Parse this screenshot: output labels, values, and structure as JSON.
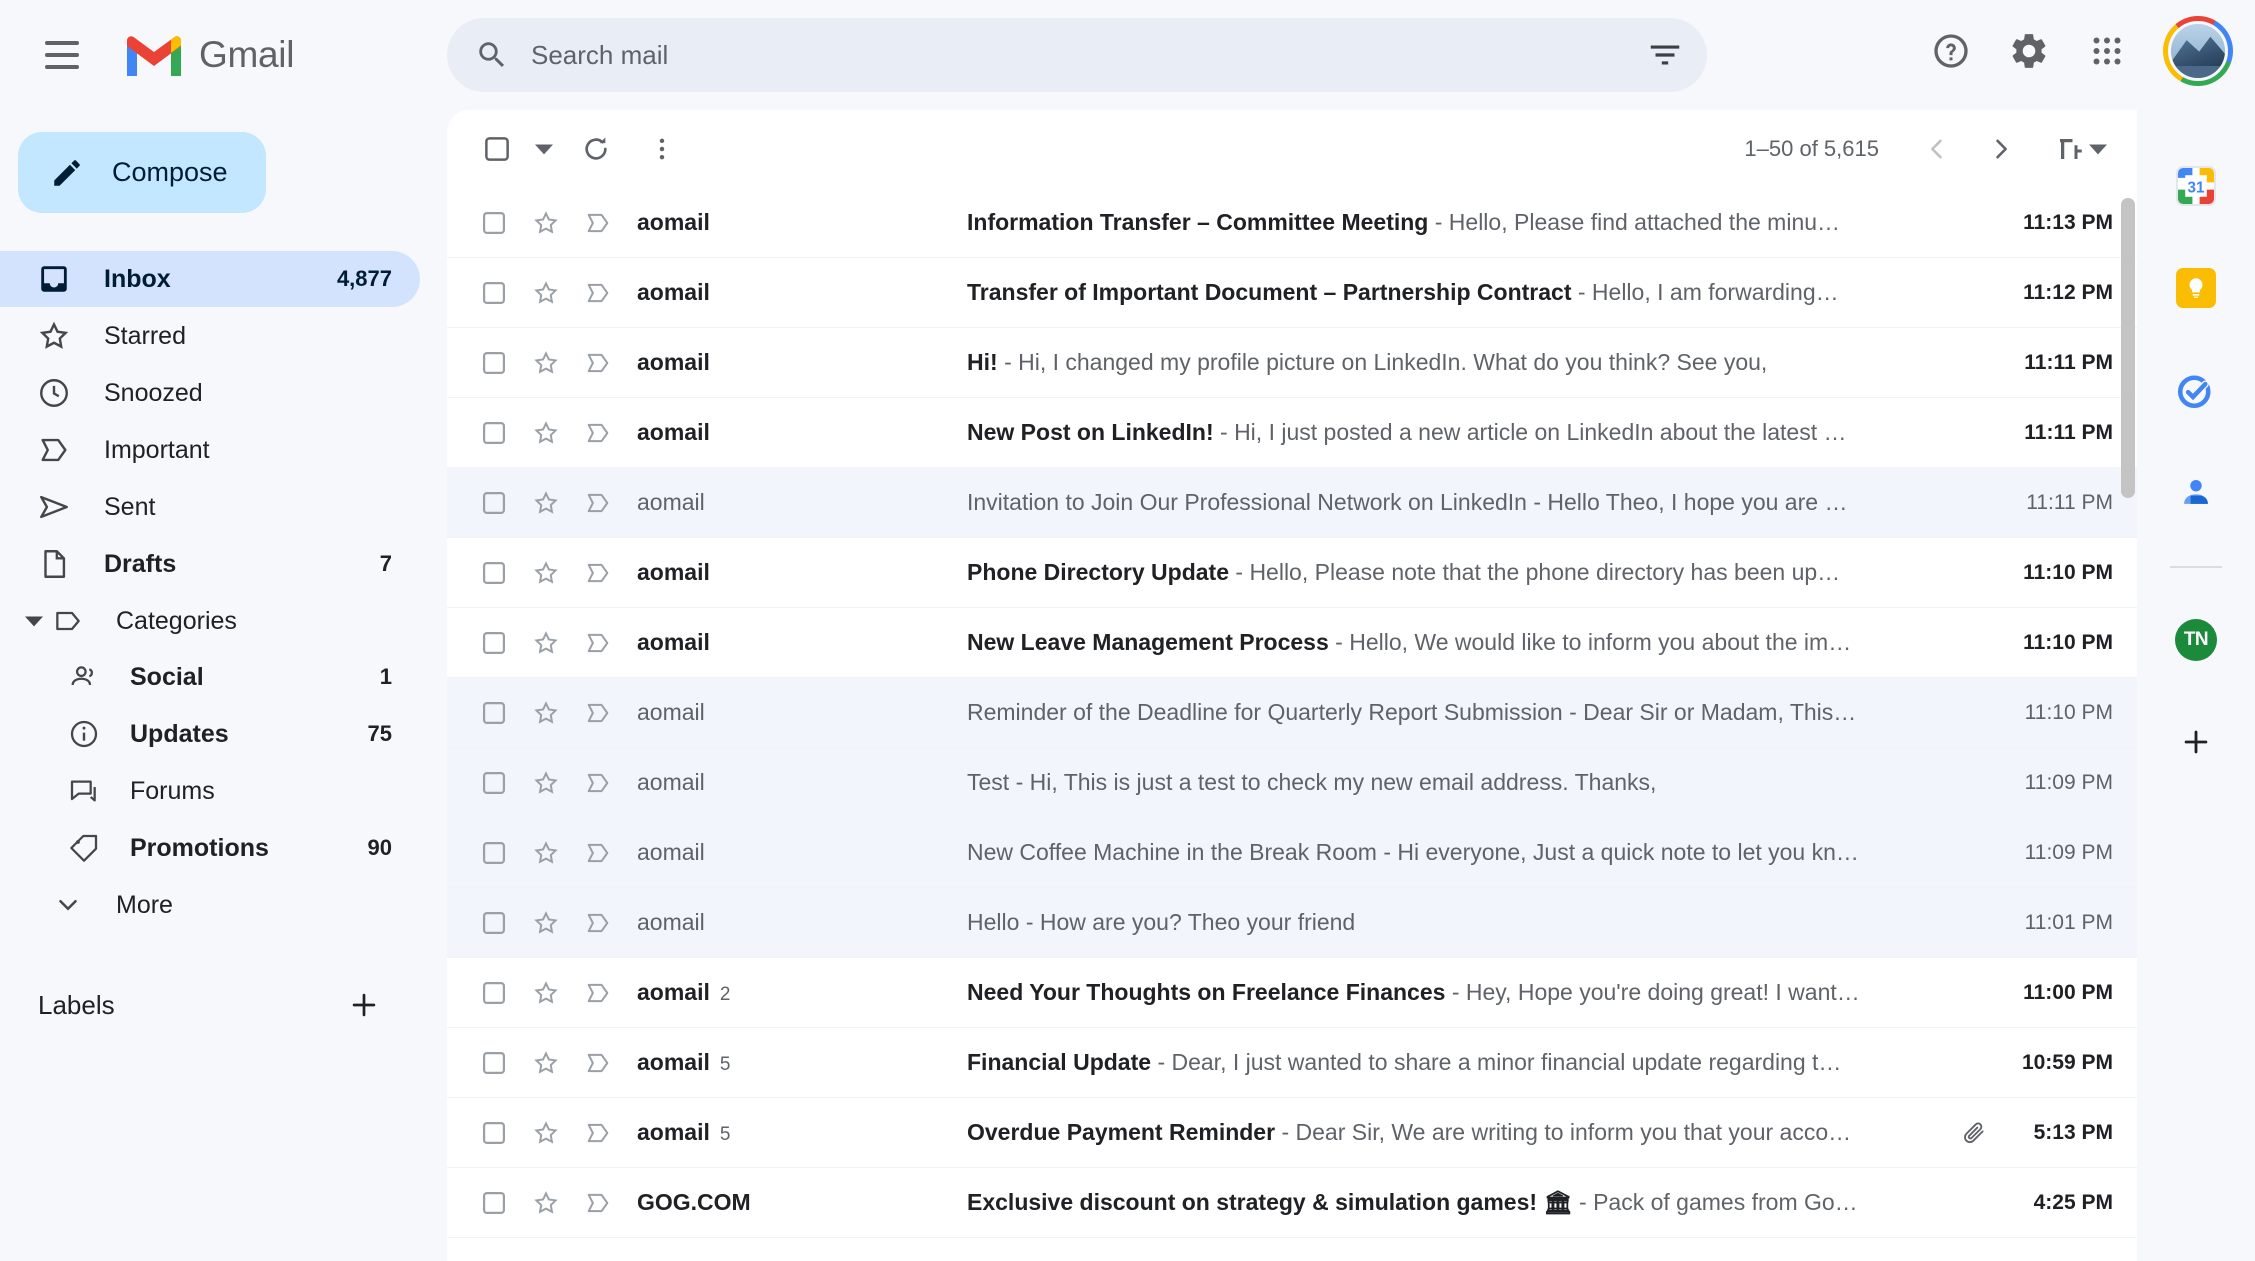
{
  "app": {
    "brand": "Gmail",
    "menu_icon": "hamburger-icon",
    "logo_icon": "gmail-logo-icon"
  },
  "search": {
    "placeholder": "Search mail",
    "value": "",
    "search_icon": "search-icon",
    "filter_icon": "tune-filter-icon"
  },
  "header_actions": {
    "help_icon": "help-icon",
    "settings_icon": "gear-icon",
    "apps_icon": "apps-grid-icon",
    "avatar": "account-avatar"
  },
  "sidebar": {
    "compose_label": "Compose",
    "compose_icon": "pencil-icon",
    "items": [
      {
        "label": "Inbox",
        "count": "4,877",
        "icon": "inbox-icon",
        "active": true,
        "bold": true
      },
      {
        "label": "Starred",
        "count": "",
        "icon": "star-icon",
        "active": false,
        "bold": false
      },
      {
        "label": "Snoozed",
        "count": "",
        "icon": "clock-icon",
        "active": false,
        "bold": false
      },
      {
        "label": "Important",
        "count": "",
        "icon": "important-icon",
        "active": false,
        "bold": false
      },
      {
        "label": "Sent",
        "count": "",
        "icon": "send-icon",
        "active": false,
        "bold": false
      },
      {
        "label": "Drafts",
        "count": "7",
        "icon": "draft-icon",
        "active": false,
        "bold": true
      }
    ],
    "categories_label": "Categories",
    "categories_icon": "label-tag-icon",
    "categories": [
      {
        "label": "Social",
        "count": "1",
        "icon": "people-icon",
        "bold": true
      },
      {
        "label": "Updates",
        "count": "75",
        "icon": "info-icon",
        "bold": true
      },
      {
        "label": "Forums",
        "count": "",
        "icon": "forum-icon",
        "bold": false
      },
      {
        "label": "Promotions",
        "count": "90",
        "icon": "offer-tag-icon",
        "bold": true
      }
    ],
    "more_label": "More",
    "more_icon": "chevron-down-icon",
    "labels_title": "Labels",
    "labels_add_icon": "plus-icon"
  },
  "toolbar": {
    "select_all_icon": "checkbox-icon",
    "select_caret_icon": "caret-down-icon",
    "refresh_icon": "refresh-icon",
    "more_icon": "more-vertical-icon",
    "page_range": "1–50 of 5,615",
    "prev_icon": "chevron-left-icon",
    "next_icon": "chevron-right-icon",
    "density_label": "F",
    "density_icon": "input-density-icon",
    "density_caret_icon": "caret-down-icon"
  },
  "emails": [
    {
      "sender": "aomail",
      "count": "",
      "subject": "Information Transfer – Committee Meeting",
      "snippet": "- Hello, Please find attached the minu…",
      "time": "11:13 PM",
      "read": false,
      "attachment": false
    },
    {
      "sender": "aomail",
      "count": "",
      "subject": "Transfer of Important Document – Partnership Contract",
      "snippet": "- Hello, I am forwarding…",
      "time": "11:12 PM",
      "read": false,
      "attachment": false
    },
    {
      "sender": "aomail",
      "count": "",
      "subject": "Hi!",
      "snippet": "- Hi, I changed my profile picture on LinkedIn. What do you think? See you,",
      "time": "11:11 PM",
      "read": false,
      "attachment": false
    },
    {
      "sender": "aomail",
      "count": "",
      "subject": "New Post on LinkedIn!",
      "snippet": "- Hi, I just posted a new article on LinkedIn about the latest …",
      "time": "11:11 PM",
      "read": false,
      "attachment": false
    },
    {
      "sender": "aomail",
      "count": "",
      "subject": "Invitation to Join Our Professional Network on LinkedIn",
      "snippet": "- Hello Theo, I hope you are …",
      "time": "11:11 PM",
      "read": true,
      "attachment": false
    },
    {
      "sender": "aomail",
      "count": "",
      "subject": "Phone Directory Update",
      "snippet": "- Hello, Please note that the phone directory has been up…",
      "time": "11:10 PM",
      "read": false,
      "attachment": false
    },
    {
      "sender": "aomail",
      "count": "",
      "subject": "New Leave Management Process",
      "snippet": "- Hello, We would like to inform you about the im…",
      "time": "11:10 PM",
      "read": false,
      "attachment": false
    },
    {
      "sender": "aomail",
      "count": "",
      "subject": "Reminder of the Deadline for Quarterly Report Submission",
      "snippet": "- Dear Sir or Madam, This…",
      "time": "11:10 PM",
      "read": true,
      "attachment": false
    },
    {
      "sender": "aomail",
      "count": "",
      "subject": "Test",
      "snippet": "- Hi, This is just a test to check my new email address. Thanks,",
      "time": "11:09 PM",
      "read": true,
      "attachment": false
    },
    {
      "sender": "aomail",
      "count": "",
      "subject": "New Coffee Machine in the Break Room",
      "snippet": "- Hi everyone, Just a quick note to let you kn…",
      "time": "11:09 PM",
      "read": true,
      "attachment": false
    },
    {
      "sender": "aomail",
      "count": "",
      "subject": "Hello",
      "snippet": "- How are you? Theo your friend",
      "time": "11:01 PM",
      "read": true,
      "attachment": false
    },
    {
      "sender": "aomail",
      "count": "2",
      "subject": "Need Your Thoughts on Freelance Finances",
      "snippet": "- Hey, Hope you're doing great! I want…",
      "time": "11:00 PM",
      "read": false,
      "attachment": false
    },
    {
      "sender": "aomail",
      "count": "5",
      "subject": "Financial Update",
      "snippet": "- Dear, I just wanted to share a minor financial update regarding t…",
      "time": "10:59 PM",
      "read": false,
      "attachment": false
    },
    {
      "sender": "aomail",
      "count": "5",
      "subject": "Overdue Payment Reminder",
      "snippet": "- Dear Sir, We are writing to inform you that your acco…",
      "time": "5:13 PM",
      "read": false,
      "attachment": true
    },
    {
      "sender": "GOG.COM",
      "count": "",
      "subject": "Exclusive discount on strategy & simulation games! 🏛",
      "snippet": "- Pack of games from Go…",
      "time": "4:25 PM",
      "read": false,
      "attachment": false
    }
  ],
  "rail": {
    "items": [
      {
        "name": "calendar-icon",
        "label": "31"
      },
      {
        "name": "keep-icon",
        "label": ""
      },
      {
        "name": "tasks-icon",
        "label": ""
      },
      {
        "name": "contacts-icon",
        "label": ""
      }
    ],
    "addon_label": "TN",
    "add_icon": "plus-icon"
  },
  "colors": {
    "accent": "#1a73e8",
    "compose_bg": "#c2e7ff",
    "active_nav": "#d3e3fd",
    "read_row": "#f2f6fc",
    "page_bg": "#f6f8fc"
  }
}
